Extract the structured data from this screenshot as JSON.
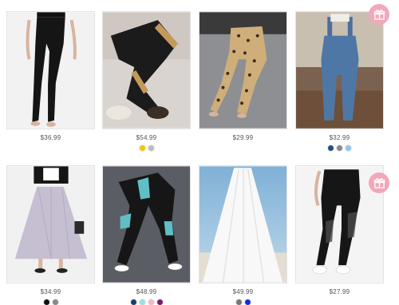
{
  "products": [
    {
      "name": "product-card-1",
      "price": "$36.99",
      "swatches": []
    },
    {
      "name": "product-card-2",
      "price": "$54.99",
      "swatches": [
        "#f5c400",
        "#bdbdbd"
      ]
    },
    {
      "name": "product-card-3",
      "price": "$29.99",
      "swatches": []
    },
    {
      "name": "product-card-4",
      "price": "$32.99",
      "swatches": [
        "#1f4e8a",
        "#8a8a8a",
        "#8fc8ef"
      ]
    },
    {
      "name": "product-card-5",
      "price": "$34.99",
      "swatches": [
        "#111111",
        "#888888"
      ]
    },
    {
      "name": "product-card-6",
      "price": "$48.99",
      "swatches": [
        "#1f3a6b",
        "#9fe0d8",
        "#f2b8c8",
        "#7a1a6a"
      ]
    },
    {
      "name": "product-card-7",
      "price": "$49.99",
      "swatches": [
        "#777777",
        "#1a2fd0"
      ]
    },
    {
      "name": "product-card-8",
      "price": "$27.99",
      "swatches": []
    }
  ],
  "icons": {
    "gift": "gift-icon"
  },
  "colors": {
    "gift_badge": "#f3a7ba",
    "price_text": "#555555"
  }
}
